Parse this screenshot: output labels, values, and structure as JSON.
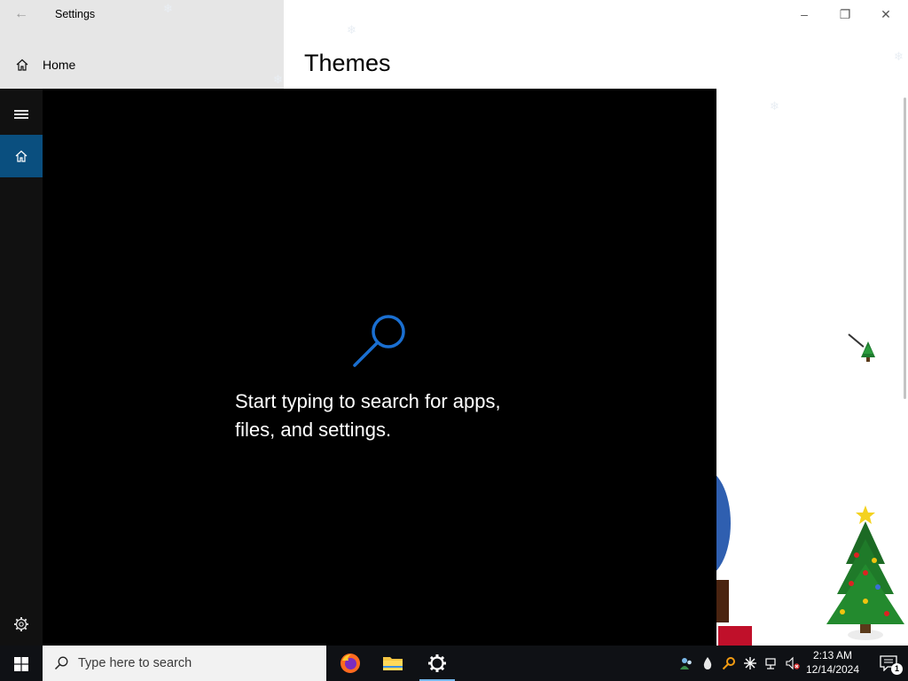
{
  "window": {
    "title": "Settings",
    "controls": {
      "minimize": "–",
      "maximize": "❐",
      "close": "✕"
    }
  },
  "sidebar": {
    "home_label": "Home"
  },
  "main": {
    "page_title": "Themes"
  },
  "search_panel": {
    "prompt_line1": "Start typing to search for apps,",
    "prompt_line2": "files, and settings."
  },
  "taskbar": {
    "search_placeholder": "Type here to search",
    "pinned_apps": [
      "firefox-icon",
      "file-explorer-icon",
      "settings-icon"
    ],
    "tray_icons": [
      "people-icon",
      "droplet-icon",
      "key-icon",
      "snowflake-icon",
      "network-icon",
      "volume-muted-icon"
    ],
    "clock": {
      "time": "2:13 AM",
      "date": "12/14/2024"
    },
    "notification_count": "1"
  },
  "colors": {
    "accent": "#0a4f7f",
    "panel_bg": "#000000",
    "taskbar_bg": "#0f1115",
    "search_icon_blue": "#1a6fd1"
  }
}
